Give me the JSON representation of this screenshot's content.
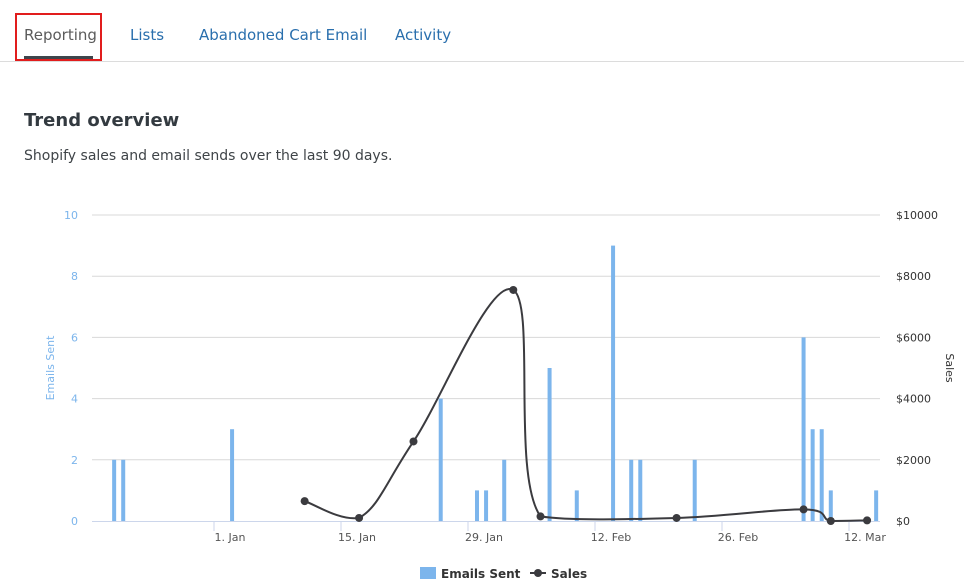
{
  "tabs": [
    {
      "label": "Reporting",
      "active": true
    },
    {
      "label": "Lists",
      "active": false
    },
    {
      "label": "Abandoned Cart Email",
      "active": false
    },
    {
      "label": "Activity",
      "active": false
    }
  ],
  "section": {
    "title": "Trend overview",
    "subtitle": "Shopify sales and email sends over the last 90 days."
  },
  "colors": {
    "bar": "#7cb5ec",
    "line": "#3b3b3f",
    "left_axis_text": "#7cb5ec",
    "right_axis_text": "#333333",
    "grid": "#d8d8d8",
    "active_tab_highlight": "#e11d1d",
    "link": "#2a6fad"
  },
  "chart_data": {
    "type": "bar+line",
    "title": "",
    "x_axis": {
      "type": "datetime",
      "tick_labels": [
        "1. Jan",
        "15. Jan",
        "29. Jan",
        "12. Feb",
        "26. Feb",
        "12. Mar"
      ],
      "tick_days_from_jan1": [
        0,
        14,
        28,
        42,
        56,
        70
      ],
      "range_days_from_jan1": [
        -13.5,
        74
      ]
    },
    "left_axis": {
      "label": "Emails Sent",
      "ticks": [
        "0",
        "2",
        "4",
        "6",
        "8",
        "10"
      ],
      "range": [
        0,
        10
      ]
    },
    "right_axis": {
      "label": "Sales",
      "ticks": [
        "$0",
        "$2000",
        "$4000",
        "$6000",
        "$8000",
        "$10000"
      ],
      "range": [
        0,
        10000
      ]
    },
    "grid": true,
    "legend": {
      "position": "bottom-center",
      "items": [
        {
          "name": "Emails Sent",
          "symbol": "bar"
        },
        {
          "name": "Sales",
          "symbol": "line-marker"
        }
      ]
    },
    "series": [
      {
        "name": "Emails Sent",
        "type": "column",
        "axis": "left",
        "points": [
          {
            "date": "20 Dec",
            "day": -12,
            "value": 2
          },
          {
            "date": "21 Dec",
            "day": -11,
            "value": 2
          },
          {
            "date": "2 Jan",
            "day": 1,
            "value": 3
          },
          {
            "date": "25 Jan",
            "day": 24,
            "value": 4
          },
          {
            "date": "29 Jan",
            "day": 28,
            "value": 1
          },
          {
            "date": "30 Jan",
            "day": 29,
            "value": 1
          },
          {
            "date": "1 Feb",
            "day": 31,
            "value": 2
          },
          {
            "date": "6 Feb",
            "day": 36,
            "value": 5
          },
          {
            "date": "9 Feb",
            "day": 39,
            "value": 1
          },
          {
            "date": "13 Feb",
            "day": 43,
            "value": 9
          },
          {
            "date": "15 Feb",
            "day": 45,
            "value": 2
          },
          {
            "date": "16 Feb",
            "day": 46,
            "value": 2
          },
          {
            "date": "22 Feb",
            "day": 52,
            "value": 2
          },
          {
            "date": "6 Mar",
            "day": 64,
            "value": 6
          },
          {
            "date": "7 Mar",
            "day": 65,
            "value": 3
          },
          {
            "date": "8 Mar",
            "day": 66,
            "value": 3
          },
          {
            "date": "9 Mar",
            "day": 67,
            "value": 1
          },
          {
            "date": "14 Mar",
            "day": 72,
            "value": 1
          }
        ]
      },
      {
        "name": "Sales",
        "type": "spline",
        "axis": "right",
        "points": [
          {
            "date": "10 Jan",
            "day": 9,
            "value": 650
          },
          {
            "date": "16 Jan",
            "day": 15,
            "value": 100
          },
          {
            "date": "22 Jan",
            "day": 21,
            "value": 2600
          },
          {
            "date": "2 Feb",
            "day": 32,
            "value": 7550
          },
          {
            "date": "5 Feb",
            "day": 35,
            "value": 150
          },
          {
            "date": "20 Feb",
            "day": 50,
            "value": 100
          },
          {
            "date": "6 Mar",
            "day": 64,
            "value": 380
          },
          {
            "date": "9 Mar",
            "day": 67,
            "value": 0
          },
          {
            "date": "13 Mar",
            "day": 71,
            "value": 20
          }
        ]
      }
    ]
  }
}
